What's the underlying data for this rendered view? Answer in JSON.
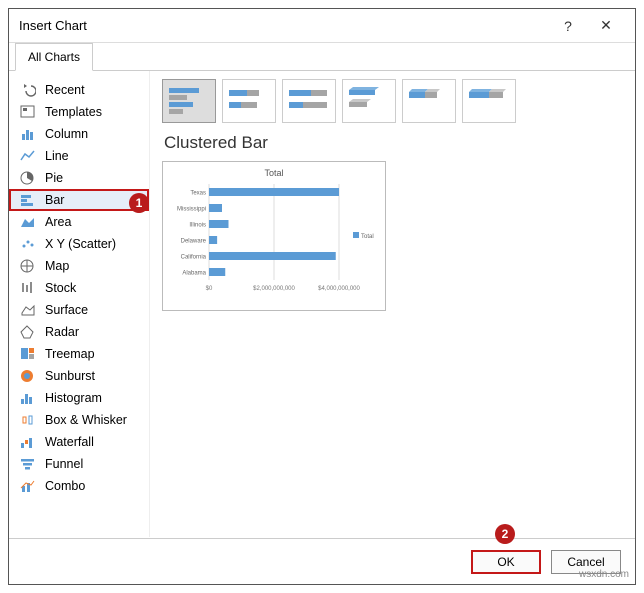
{
  "title": "Insert Chart",
  "help_symbol": "?",
  "close_symbol": "✕",
  "tabs": {
    "all": "All Charts"
  },
  "categories": [
    {
      "label": "Recent"
    },
    {
      "label": "Templates"
    },
    {
      "label": "Column"
    },
    {
      "label": "Line"
    },
    {
      "label": "Pie"
    },
    {
      "label": "Bar",
      "selected": true
    },
    {
      "label": "Area"
    },
    {
      "label": "X Y (Scatter)"
    },
    {
      "label": "Map"
    },
    {
      "label": "Stock"
    },
    {
      "label": "Surface"
    },
    {
      "label": "Radar"
    },
    {
      "label": "Treemap"
    },
    {
      "label": "Sunburst"
    },
    {
      "label": "Histogram"
    },
    {
      "label": "Box & Whisker"
    },
    {
      "label": "Waterfall"
    },
    {
      "label": "Funnel"
    },
    {
      "label": "Combo"
    }
  ],
  "subtype_title": "Clustered Bar",
  "preview": {
    "title": "Total",
    "legend": "Total",
    "categories": [
      "Texas",
      "Mississippi",
      "Illinois",
      "Delaware",
      "California",
      "Alabama"
    ],
    "xticks": [
      "$0",
      "$2,000,000,000",
      "$4,000,000,000"
    ]
  },
  "chart_data": {
    "type": "bar",
    "orientation": "horizontal",
    "title": "Total",
    "categories": [
      "Texas",
      "Mississippi",
      "Illinois",
      "Delaware",
      "California",
      "Alabama"
    ],
    "values": [
      4000000000,
      400000000,
      600000000,
      250000000,
      3900000000,
      500000000
    ],
    "series_name": "Total",
    "xlim": [
      0,
      4000000000
    ],
    "xticks": [
      0,
      2000000000,
      4000000000
    ]
  },
  "annotations": {
    "badge1": "1",
    "badge2": "2"
  },
  "buttons": {
    "ok": "OK",
    "cancel": "Cancel"
  },
  "watermark": "wsxdn.com"
}
